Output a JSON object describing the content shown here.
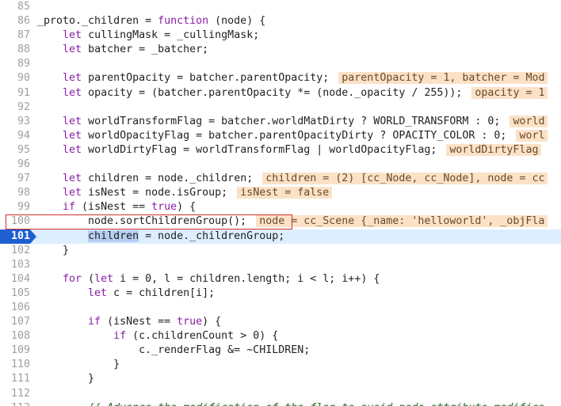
{
  "lines": [
    {
      "n": "85",
      "segs": []
    },
    {
      "n": "86",
      "segs": [
        [
          "t",
          "_proto._children = "
        ],
        [
          "kw",
          "function"
        ],
        [
          "t",
          " (node) {"
        ]
      ]
    },
    {
      "n": "87",
      "segs": [
        [
          "t",
          "    "
        ],
        [
          "kw",
          "let"
        ],
        [
          "t",
          " cullingMask = _cullingMask;"
        ]
      ]
    },
    {
      "n": "88",
      "segs": [
        [
          "t",
          "    "
        ],
        [
          "kw",
          "let"
        ],
        [
          "t",
          " batcher = _batcher;"
        ]
      ]
    },
    {
      "n": "89",
      "segs": []
    },
    {
      "n": "90",
      "segs": [
        [
          "t",
          "    "
        ],
        [
          "kw",
          "let"
        ],
        [
          "t",
          " parentOpacity = batcher.parentOpacity; "
        ],
        [
          "hint",
          "parentOpacity = 1, batcher = Mod"
        ]
      ]
    },
    {
      "n": "91",
      "segs": [
        [
          "t",
          "    "
        ],
        [
          "kw",
          "let"
        ],
        [
          "t",
          " opacity = (batcher.parentOpacity *= (node._opacity / 255)); "
        ],
        [
          "hint",
          "opacity = 1"
        ]
      ]
    },
    {
      "n": "92",
      "segs": []
    },
    {
      "n": "93",
      "segs": [
        [
          "t",
          "    "
        ],
        [
          "kw",
          "let"
        ],
        [
          "t",
          " worldTransformFlag = batcher.worldMatDirty ? WORLD_TRANSFORM : 0; "
        ],
        [
          "hint",
          "world"
        ]
      ]
    },
    {
      "n": "94",
      "segs": [
        [
          "t",
          "    "
        ],
        [
          "kw",
          "let"
        ],
        [
          "t",
          " worldOpacityFlag = batcher.parentOpacityDirty ? OPACITY_COLOR : 0; "
        ],
        [
          "hint",
          "worl"
        ]
      ]
    },
    {
      "n": "95",
      "segs": [
        [
          "t",
          "    "
        ],
        [
          "kw",
          "let"
        ],
        [
          "t",
          " worldDirtyFlag = worldTransformFlag | worldOpacityFlag; "
        ],
        [
          "hint",
          "worldDirtyFlag"
        ]
      ]
    },
    {
      "n": "96",
      "segs": []
    },
    {
      "n": "97",
      "segs": [
        [
          "t",
          "    "
        ],
        [
          "kw",
          "let"
        ],
        [
          "t",
          " children = node._children; "
        ],
        [
          "hint",
          "children = (2) [cc_Node, cc_Node], node = cc"
        ]
      ]
    },
    {
      "n": "98",
      "segs": [
        [
          "t",
          "    "
        ],
        [
          "kw",
          "let"
        ],
        [
          "t",
          " isNest = node.isGroup; "
        ],
        [
          "hint",
          "isNest = false"
        ]
      ]
    },
    {
      "n": "99",
      "segs": [
        [
          "t",
          "    "
        ],
        [
          "kw",
          "if"
        ],
        [
          "t",
          " (isNest == "
        ],
        [
          "kw",
          "true"
        ],
        [
          "t",
          ") {"
        ]
      ]
    },
    {
      "n": "100",
      "segs": [
        [
          "t",
          "        node.sortChildrenGroup(); "
        ],
        [
          "hint",
          "node = cc_Scene {_name: 'helloworld', _objFla"
        ]
      ]
    },
    {
      "n": "101",
      "current": true,
      "segs": [
        [
          "t",
          "        "
        ],
        [
          "sel",
          "children"
        ],
        [
          "t",
          " = node._childrenGroup;"
        ]
      ]
    },
    {
      "n": "102",
      "segs": [
        [
          "t",
          "    }"
        ]
      ]
    },
    {
      "n": "103",
      "segs": []
    },
    {
      "n": "104",
      "segs": [
        [
          "t",
          "    "
        ],
        [
          "kw",
          "for"
        ],
        [
          "t",
          " ("
        ],
        [
          "kw",
          "let"
        ],
        [
          "t",
          " i = 0, l = children.length; i < l; i++) {"
        ]
      ]
    },
    {
      "n": "105",
      "segs": [
        [
          "t",
          "        "
        ],
        [
          "kw",
          "let"
        ],
        [
          "t",
          " c = children[i];"
        ]
      ]
    },
    {
      "n": "106",
      "segs": []
    },
    {
      "n": "107",
      "segs": [
        [
          "t",
          "        "
        ],
        [
          "kw",
          "if"
        ],
        [
          "t",
          " (isNest == "
        ],
        [
          "kw",
          "true"
        ],
        [
          "t",
          ") {"
        ]
      ]
    },
    {
      "n": "108",
      "segs": [
        [
          "t",
          "            "
        ],
        [
          "kw",
          "if"
        ],
        [
          "t",
          " (c.childrenCount > 0) {"
        ]
      ]
    },
    {
      "n": "109",
      "segs": [
        [
          "t",
          "                c._renderFlag &= ~CHILDREN;"
        ]
      ]
    },
    {
      "n": "110",
      "segs": [
        [
          "t",
          "            }"
        ]
      ]
    },
    {
      "n": "111",
      "segs": [
        [
          "t",
          "        }"
        ]
      ]
    },
    {
      "n": "112",
      "segs": []
    },
    {
      "n": "113",
      "segs": [
        [
          "cmt",
          "        // Advance the modification of the flag to avoid node attribute modifica"
        ]
      ]
    }
  ]
}
